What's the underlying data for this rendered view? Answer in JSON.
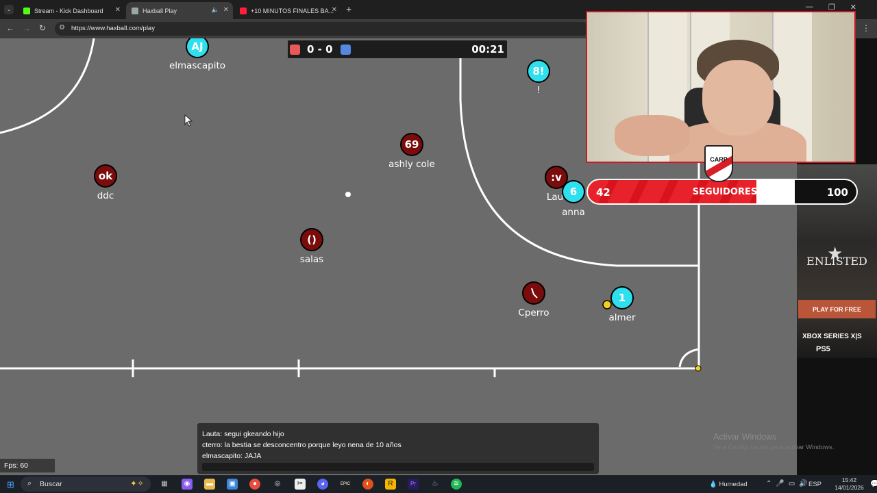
{
  "browser": {
    "tabs": [
      {
        "title": "Stream - Kick Dashboard",
        "favicon_color": "#53fc18"
      },
      {
        "title": "Haxball Play",
        "favicon_color": "#9aa8a0",
        "audio_icon": "speaker-icon"
      },
      {
        "title": "+10 MINUTOS FINALES BA...",
        "favicon_color": "#ff1f3d"
      }
    ],
    "url": "https://www.haxball.com/play"
  },
  "game": {
    "score": "0 - 0",
    "timer": "00:21",
    "red_color": "#e85a5a",
    "blue_color": "#5588e0",
    "players": [
      {
        "avatar": "AJ",
        "name": "elmascapito",
        "team": "blue"
      },
      {
        "avatar": "8!",
        "name": "!",
        "team": "blue"
      },
      {
        "avatar": "69",
        "name": "ashly cole",
        "team": "red"
      },
      {
        "avatar": "ok",
        "name": "ddc",
        "team": "red"
      },
      {
        "avatar": ":v",
        "name": "Lau",
        "team": "red"
      },
      {
        "avatar": "6",
        "name": "anna",
        "team": "blue"
      },
      {
        "avatar": "()",
        "name": "salas",
        "team": "red"
      },
      {
        "avatar": "",
        "name": "Cperro",
        "team": "red"
      },
      {
        "avatar": "1",
        "name": "almer",
        "team": "blue"
      }
    ],
    "chat": [
      "Lauta: segui gkeando hijo",
      "cterro: la bestia se desconcentro porque leyo nena de 10 años",
      "elmascapito: JAJA"
    ],
    "fps": "Fps: 60"
  },
  "overlay": {
    "followers_current": "42",
    "followers_label": "SEGUIDORES",
    "followers_goal": "100",
    "followers_progress": 0.42,
    "crest_text": "CARP"
  },
  "ad": {
    "brand": "ENLISTED",
    "cta": "PLAY FOR FREE",
    "platforms": [
      "XBOX SERIES X|S",
      "PS5"
    ]
  },
  "windows": {
    "activate_title": "Activar Windows",
    "activate_sub": "Ve a Configuración para activar Windows."
  },
  "taskbar": {
    "search_placeholder": "Buscar",
    "weather": "Humedad",
    "lang": "ESP",
    "time": "15:42",
    "date": "14/01/2026"
  }
}
